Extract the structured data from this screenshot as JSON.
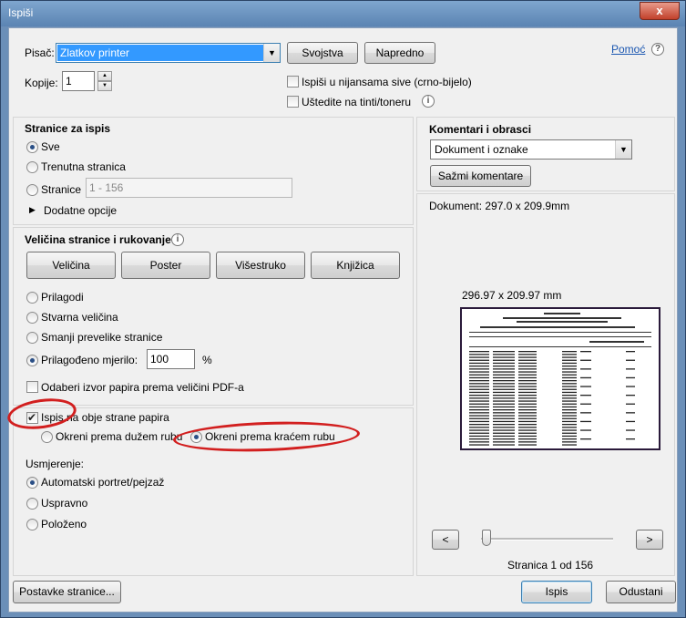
{
  "window": {
    "title": "Ispiši",
    "close_label": "x"
  },
  "printer": {
    "label": "Pisač:",
    "selected": "Zlatkov printer",
    "properties_label": "Svojstva",
    "advanced_label": "Napredno",
    "help_label": "Pomoć",
    "copies_label": "Kopije:",
    "copies_value": "1",
    "grayscale_label": "Ispiši u nijansama sive (crno-bijelo)",
    "grayscale_checked": false,
    "save_ink_label": "Uštedite na tinti/toneru",
    "save_ink_checked": false
  },
  "pages": {
    "title": "Stranice za ispis",
    "all_label": "Sve",
    "current_label": "Trenutna stranica",
    "pages_label": "Stranice",
    "pages_range": "1 - 156",
    "more_options_label": "Dodatne opcije",
    "selected": "all"
  },
  "sizing": {
    "title": "Veličina stranice i rukovanje",
    "tabs": [
      "Veličina",
      "Poster",
      "Višestruko",
      "Knjižica"
    ],
    "fit_label": "Prilagodi",
    "actual_label": "Stvarna veličina",
    "shrink_label": "Smanji prevelike stranice",
    "custom_scale_label": "Prilagođeno mjerilo:",
    "custom_scale_value": "100",
    "percent": "%",
    "paper_source_label": "Odaberi izvor papira prema veličini PDF-a",
    "selected": "custom"
  },
  "duplex": {
    "both_sides_label": "Ispis na obje strane papira",
    "both_sides_checked": true,
    "long_edge_label": "Okreni prema dužem rubu",
    "short_edge_label": "Okreni prema kraćem rubu",
    "selected": "short"
  },
  "orientation": {
    "title": "Usmjerenje:",
    "auto_label": "Automatski portret/pejzaž",
    "portrait_label": "Uspravno",
    "landscape_label": "Položeno",
    "selected": "auto"
  },
  "comments": {
    "title": "Komentari i obrasci",
    "selected": "Dokument i oznake",
    "summarize_label": "Sažmi komentare"
  },
  "preview": {
    "document_size": "Dokument: 297.0 x 209.9mm",
    "page_size": "296.97 x 209.97 mm",
    "prev_label": "<",
    "next_label": ">",
    "page_status": "Stranica 1 od 156"
  },
  "footer": {
    "page_setup_label": "Postavke stranice...",
    "print_label": "Ispis",
    "cancel_label": "Odustani"
  },
  "colors": {
    "highlight": "#d21f1f",
    "selection": "#3399ff",
    "titlebar": "#6b8fb8"
  }
}
